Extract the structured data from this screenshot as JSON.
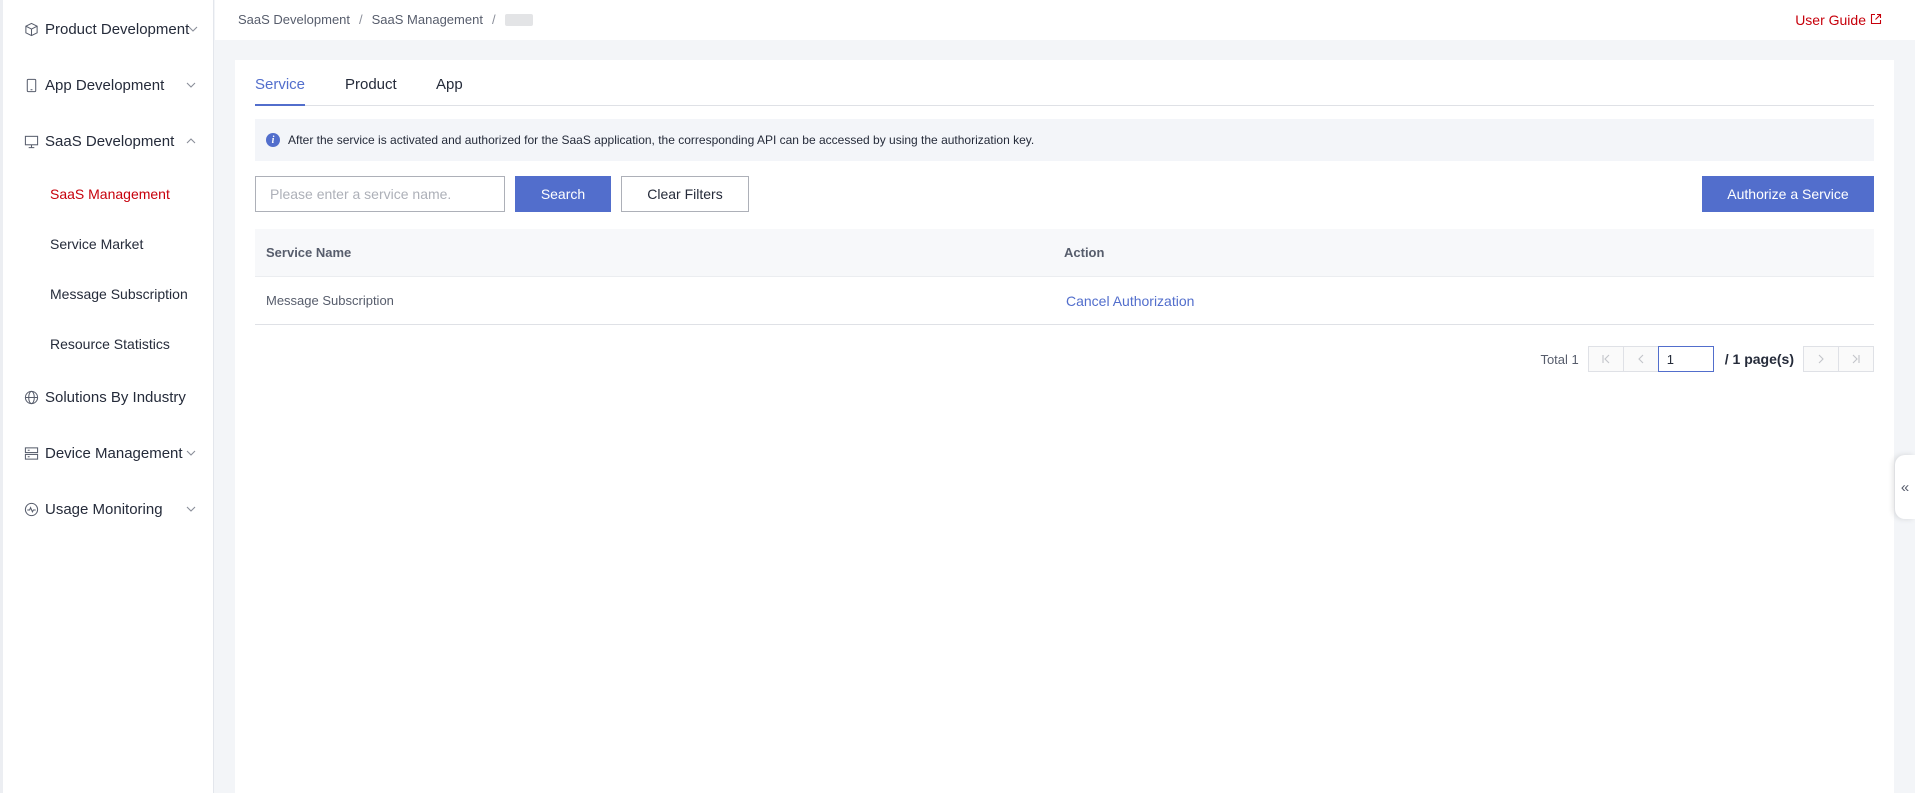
{
  "sidebar": {
    "groups": [
      {
        "label": "Product Development",
        "icon": "cube-icon",
        "expanded": false
      },
      {
        "label": "App Development",
        "icon": "mobile-icon",
        "expanded": false
      },
      {
        "label": "SaaS Development",
        "icon": "monitor-icon",
        "expanded": true
      },
      {
        "label": "Solutions By Industry",
        "icon": "globe-icon",
        "expanded": false
      },
      {
        "label": "Device Management",
        "icon": "server-icon",
        "expanded": false
      },
      {
        "label": "Usage Monitoring",
        "icon": "pulse-icon",
        "expanded": false
      }
    ],
    "saas_items": [
      {
        "label": "SaaS Management",
        "active": true
      },
      {
        "label": "Service Market",
        "active": false
      },
      {
        "label": "Message Subscription",
        "active": false
      },
      {
        "label": "Resource Statistics",
        "active": false
      }
    ]
  },
  "header": {
    "breadcrumb": [
      "SaaS Development",
      "SaaS Management"
    ],
    "separator": "/",
    "user_guide": "User Guide"
  },
  "tabs": [
    {
      "label": "Service",
      "active": true
    },
    {
      "label": "Product",
      "active": false
    },
    {
      "label": "App",
      "active": false
    }
  ],
  "alert": {
    "text": "After the service is activated and authorized for the SaaS application, the corresponding API can be accessed by using the authorization key."
  },
  "filters": {
    "search_placeholder": "Please enter a service name.",
    "search_value": "",
    "search_button": "Search",
    "clear_button": "Clear Filters",
    "authorize_button": "Authorize a Service"
  },
  "table": {
    "columns": [
      "Service Name",
      "Action"
    ],
    "rows": [
      {
        "service_name": "Message Subscription",
        "action": "Cancel Authorization"
      }
    ]
  },
  "pagination": {
    "total_label": "Total 1",
    "current_page": "1",
    "page_count_label": "/ 1 page(s)"
  },
  "colors": {
    "accent": "#526ecc",
    "brand_red": "#c7000b",
    "text": "#252b3a",
    "background": "#f3f5f8"
  }
}
